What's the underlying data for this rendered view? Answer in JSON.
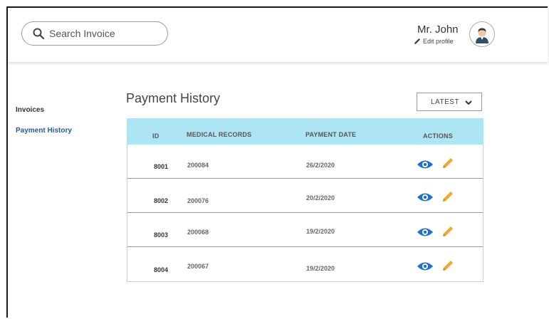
{
  "header": {
    "search": {
      "placeholder": "Search Invoice"
    },
    "user": {
      "name": "Mr. John",
      "edit_label": "Edit profile"
    }
  },
  "sidebar": {
    "items": [
      {
        "label": "Invoices",
        "active": false
      },
      {
        "label": "Payment History",
        "active": true
      }
    ]
  },
  "main": {
    "title": "Payment History",
    "sort": {
      "selected": "LATEST"
    },
    "table": {
      "columns": [
        "ID",
        "MEDICAL RECORDS",
        "PAYMENT DATE",
        "ACTIONS"
      ],
      "rows": [
        {
          "id": "8001",
          "medical_record": "200084",
          "payment_date": "26/2/2020"
        },
        {
          "id": "8002",
          "medical_record": "200076",
          "payment_date": "20/2/2020"
        },
        {
          "id": "8003",
          "medical_record": "200068",
          "payment_date": "19/2/2020"
        },
        {
          "id": "8004",
          "medical_record": "200067",
          "payment_date": "19/2/2020"
        }
      ]
    }
  },
  "colors": {
    "accent": "#1f5fa8",
    "table_header_bg": "#aee5f5",
    "view_icon": "#1e6fd0",
    "edit_icon": "#f5a623"
  },
  "icons": {
    "search": "search-icon",
    "edit_profile": "pencil-icon",
    "avatar": "user-avatar-icon",
    "sort": "chevron-down-icon",
    "view": "eye-icon",
    "edit": "pencil-icon"
  }
}
